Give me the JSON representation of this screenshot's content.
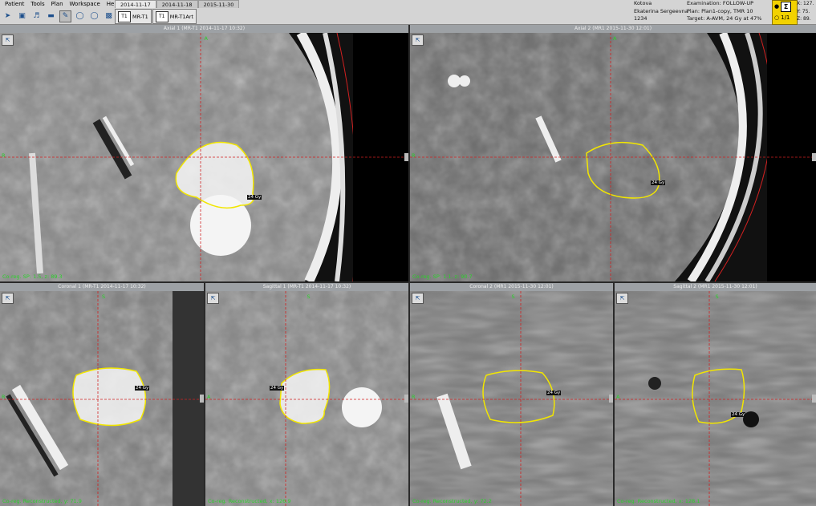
{
  "menu": [
    "Patient",
    "Tools",
    "Plan",
    "Workspace",
    "Help"
  ],
  "toolbar_icons": [
    "pointer-icon",
    "cube-icon",
    "signal-icon",
    "bar-icon",
    "pen-icon",
    "contour-icon",
    "cylinder-icon",
    "screen-icon"
  ],
  "date_tabs": [
    "2014-11-17",
    "2014-11-18",
    "2015-11-30"
  ],
  "series_tabs": [
    "MR-T1",
    "MR-T1Art"
  ],
  "patient": {
    "name": "Kotova",
    "fullname": "Ekaterina Sergeevna",
    "id": "1234",
    "exam": "Examination: FOLLOW-UP",
    "plan": "Plan: Plan1-copy, TMR 10",
    "target": "Target: A-AVM, 24 Gy at 47%"
  },
  "sigma": {
    "sum": "Σ",
    "page": "1/1"
  },
  "coords": {
    "x": "X: 127.",
    "y": "Y:  75.",
    "z": "Z:  89."
  },
  "viewports": [
    {
      "title": "Axial 1 (MR-T1 2014-11-17 10:32)",
      "footer": "Co-reg. SP: 1.5, z: 89.3",
      "top": "A",
      "left": "R",
      "dose": "24 Gy"
    },
    {
      "title": "Axial 2 (MR1 2015-11-30 12:01)",
      "footer": "Co-reg. SP: 1.1, z: 90.7",
      "top": "A",
      "left": "R",
      "dose": "24 Gy"
    },
    {
      "title": "Coronal 1 (MR-T1 2014-11-17 10:32)",
      "footer": "Co-reg. Reconstructed, y: 71.9",
      "top": "S",
      "left": "R",
      "dose": "24 Gy"
    },
    {
      "title": "Sagittal 1 (MR-T1 2014-11-17 10:32)",
      "footer": "Co-reg. Reconstructed, x: 126.9",
      "top": "S",
      "left": "A",
      "dose": "24 Gy"
    },
    {
      "title": "Coronal 2 (MR1 2015-11-30 12:01)",
      "footer": "Co-reg. Reconstructed, y: 72.2",
      "top": "S",
      "left": "R",
      "dose": "24 Gy"
    },
    {
      "title": "Sagittal 2 (MR1 2015-11-30 12:01)",
      "footer": "Co-reg. Reconstructed, x: 128.1",
      "top": "S",
      "left": "A",
      "dose": "24 Gy"
    }
  ],
  "colors": {
    "contour": "#f2e600",
    "crosshair": "#d22020",
    "orient": "#2bd22b"
  }
}
